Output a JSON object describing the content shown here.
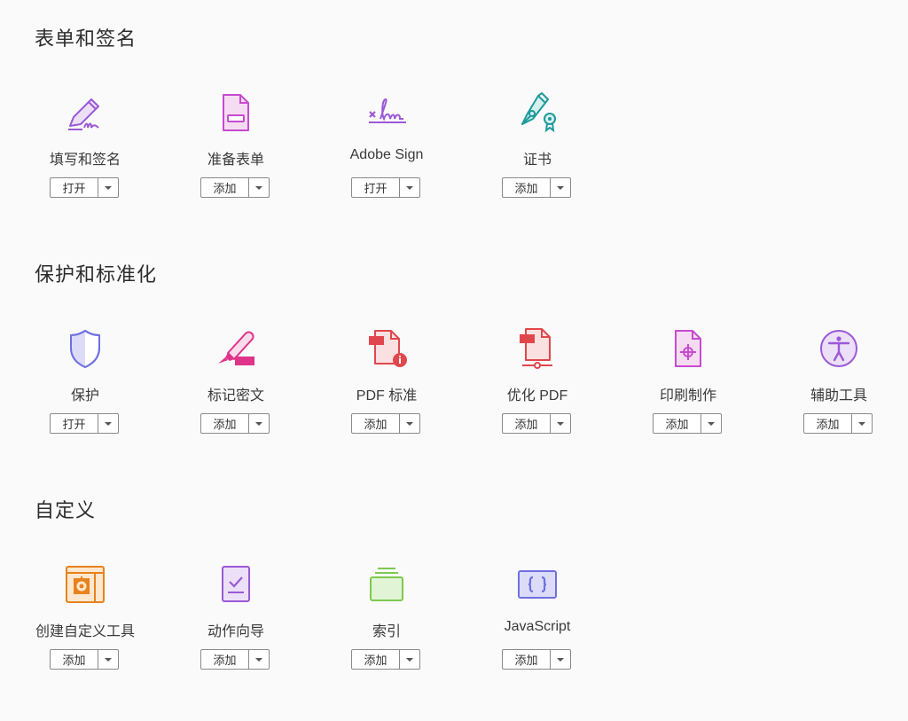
{
  "sections": [
    {
      "title": "表单和签名"
    },
    {
      "title": "保护和标准化"
    },
    {
      "title": "自定义"
    }
  ],
  "tools": {
    "fill_sign": {
      "label": "填写和签名",
      "action": "打开",
      "icon": "pen-sign-icon"
    },
    "prepare_form": {
      "label": "准备表单",
      "action": "添加",
      "icon": "form-icon"
    },
    "adobe_sign": {
      "label": "Adobe Sign",
      "action": "打开",
      "icon": "signature-icon"
    },
    "certificates": {
      "label": "证书",
      "action": "添加",
      "icon": "certificate-pen-icon"
    },
    "protect": {
      "label": "保护",
      "action": "打开",
      "icon": "shield-icon"
    },
    "redact": {
      "label": "标记密文",
      "action": "添加",
      "icon": "redact-marker-icon"
    },
    "pdf_standards": {
      "label": "PDF 标准",
      "action": "添加",
      "icon": "pdf-standard-icon"
    },
    "optimize_pdf": {
      "label": "优化 PDF",
      "action": "添加",
      "icon": "optimize-pdf-icon"
    },
    "print_production": {
      "label": "印刷制作",
      "action": "添加",
      "icon": "print-production-icon"
    },
    "accessibility": {
      "label": "辅助工具",
      "action": "添加",
      "icon": "accessibility-icon"
    },
    "custom_tool": {
      "label": "创建自定义工具",
      "action": "添加",
      "icon": "custom-tool-gear-icon"
    },
    "action_wizard": {
      "label": "动作向导",
      "action": "添加",
      "icon": "action-wizard-icon"
    },
    "index": {
      "label": "索引",
      "action": "添加",
      "icon": "index-stack-icon"
    },
    "javascript": {
      "label": "JavaScript",
      "action": "添加",
      "icon": "javascript-braces-icon"
    }
  },
  "colors": {
    "purple": "#9b59d6",
    "magenta": "#c64bcf",
    "teal": "#1e9a9a",
    "indigo": "#6f6fe0",
    "pink": "#e0338a",
    "red": "#e0474c",
    "orange": "#e8821e",
    "green": "#7ec850",
    "text": "#2c2c2c"
  }
}
